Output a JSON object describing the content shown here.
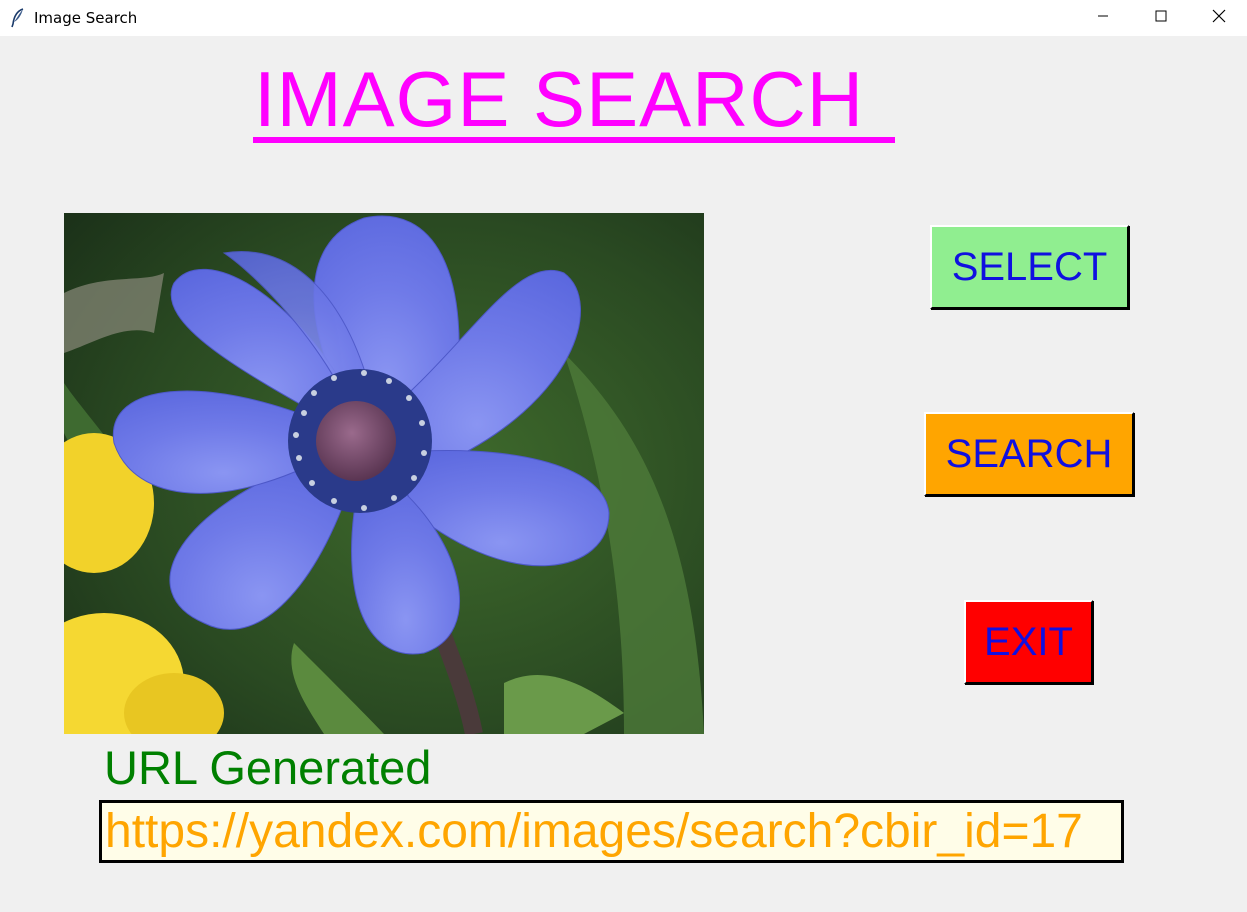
{
  "window": {
    "title": "Image Search",
    "app_icon": "feather-icon",
    "controls": {
      "minimize": "minimize-icon",
      "maximize": "maximize-icon",
      "close": "close-icon"
    }
  },
  "header": {
    "title": "IMAGE SEARCH",
    "title_color": "#ff00ff"
  },
  "preview": {
    "subject": "blue anemone flower photo"
  },
  "buttons": {
    "select": {
      "label": "SELECT",
      "color": "#90ee90"
    },
    "search": {
      "label": "SEARCH",
      "color": "#ffa500"
    },
    "exit": {
      "label": "EXIT",
      "color": "#ff0000"
    },
    "text_color": "#1010e0"
  },
  "result": {
    "label": "URL Generated",
    "label_color": "#008000",
    "url": "https://yandex.com/images/search?cbir_id=17",
    "url_color": "#ffa500"
  }
}
